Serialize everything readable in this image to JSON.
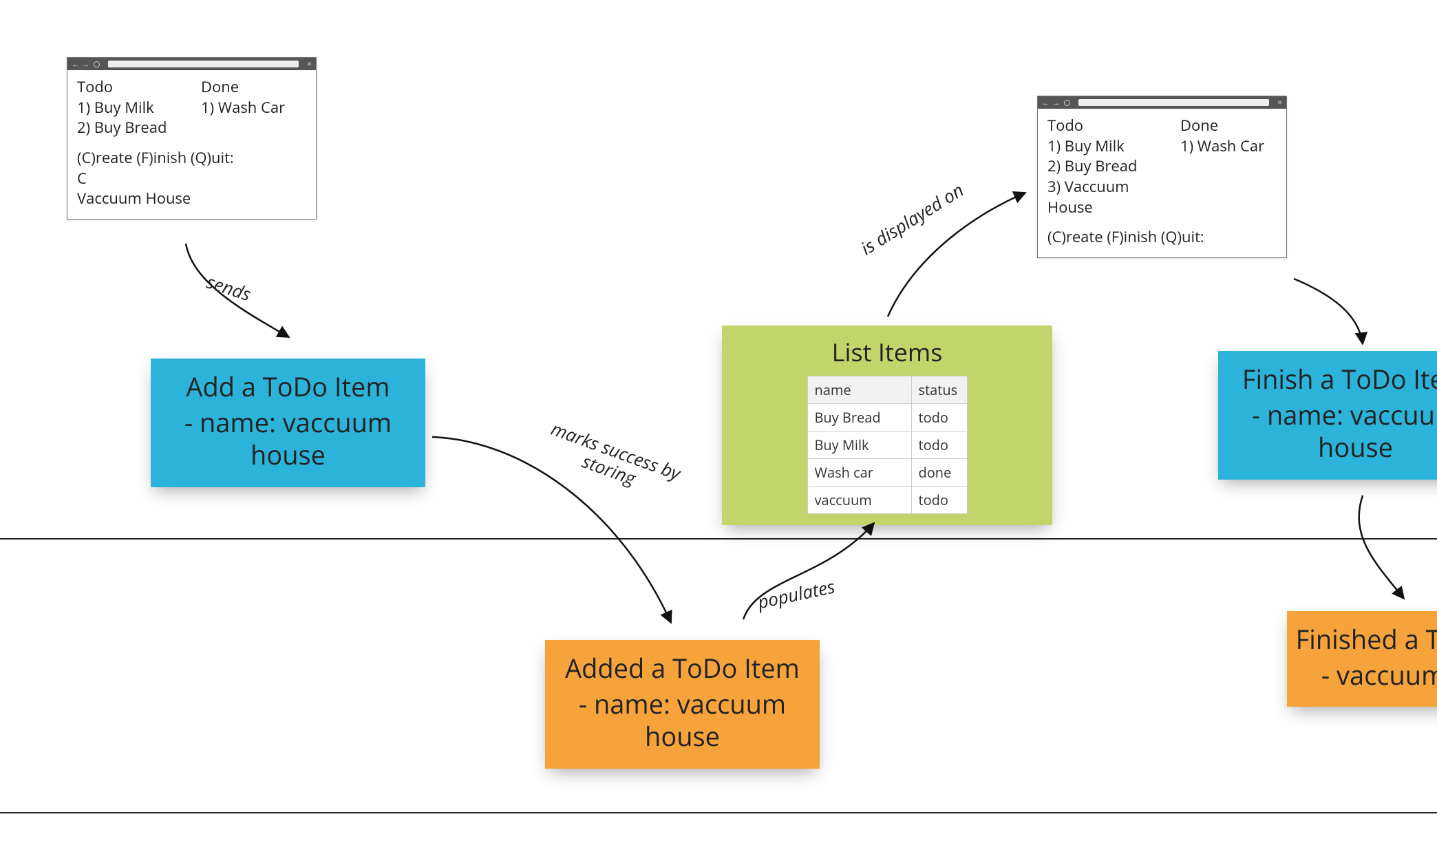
{
  "browser1": {
    "todo_header": "Todo",
    "done_header": "Done",
    "todo_items": [
      "1) Buy Milk",
      "2) Buy Bread"
    ],
    "done_items": [
      "1) Wash Car"
    ],
    "prompt": "(C)reate (F)inish (Q)uit:",
    "input_choice": "C",
    "input_value": "Vaccuum House"
  },
  "browser2": {
    "todo_header": "Todo",
    "done_header": "Done",
    "todo_items": [
      "1) Buy Milk",
      "2) Buy Bread",
      "3) Vaccuum House"
    ],
    "done_items": [
      "1) Wash Car"
    ],
    "prompt": "(C)reate (F)inish (Q)uit:"
  },
  "cards": {
    "add": {
      "title": "Add a ToDo Item",
      "sub": "- name: vaccuum house"
    },
    "added": {
      "title": "Added a ToDo Item",
      "sub": "- name: vaccuum house"
    },
    "finish": {
      "title": "Finish a ToDo Item",
      "sub": "- name: vaccuum house"
    },
    "finished": {
      "title": "Finished a ToDo Item",
      "sub": "- vaccuum house"
    }
  },
  "list_card": {
    "header": "List Items",
    "columns": [
      "name",
      "status"
    ],
    "rows": [
      {
        "name": "Buy Bread",
        "status": "todo"
      },
      {
        "name": "Buy Milk",
        "status": "todo"
      },
      {
        "name": "Wash car",
        "status": "done"
      },
      {
        "name": "vaccuum",
        "status": "todo"
      }
    ]
  },
  "edges": {
    "sends": "sends",
    "marks": "marks success by storing",
    "populates": "populates",
    "displayed": "is displayed on"
  }
}
